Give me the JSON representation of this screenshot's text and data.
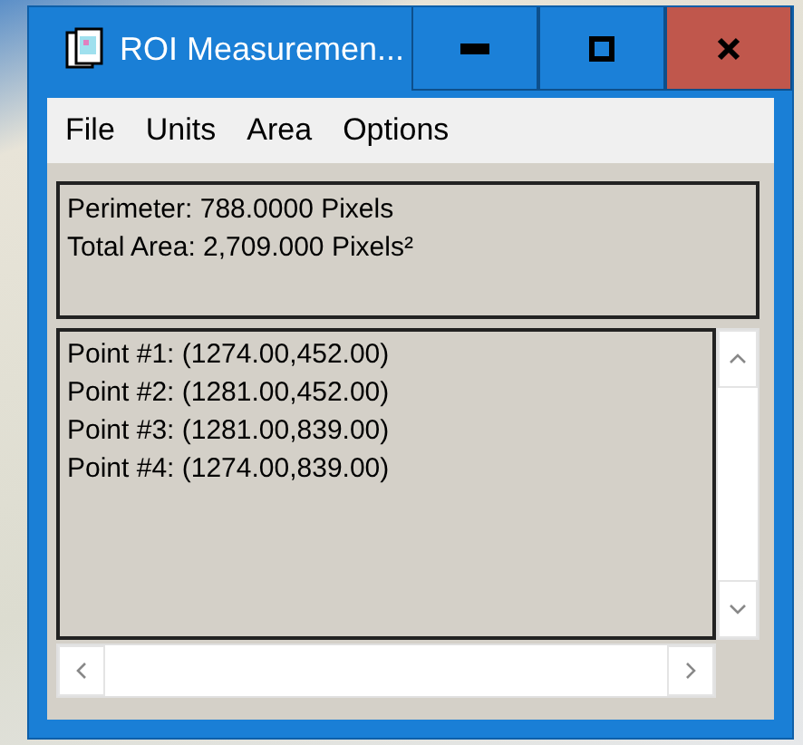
{
  "window": {
    "title": "ROI Measuremen..."
  },
  "menu": [
    "File",
    "Units",
    "Area",
    "Options"
  ],
  "summary": [
    "Perimeter: 788.0000 Pixels",
    "Total Area: 2,709.000 Pixels²"
  ],
  "points": [
    "Point #1: (1274.00,452.00)",
    "Point #2: (1281.00,452.00)",
    "Point #3: (1281.00,839.00)",
    "Point #4: (1274.00,839.00)"
  ]
}
